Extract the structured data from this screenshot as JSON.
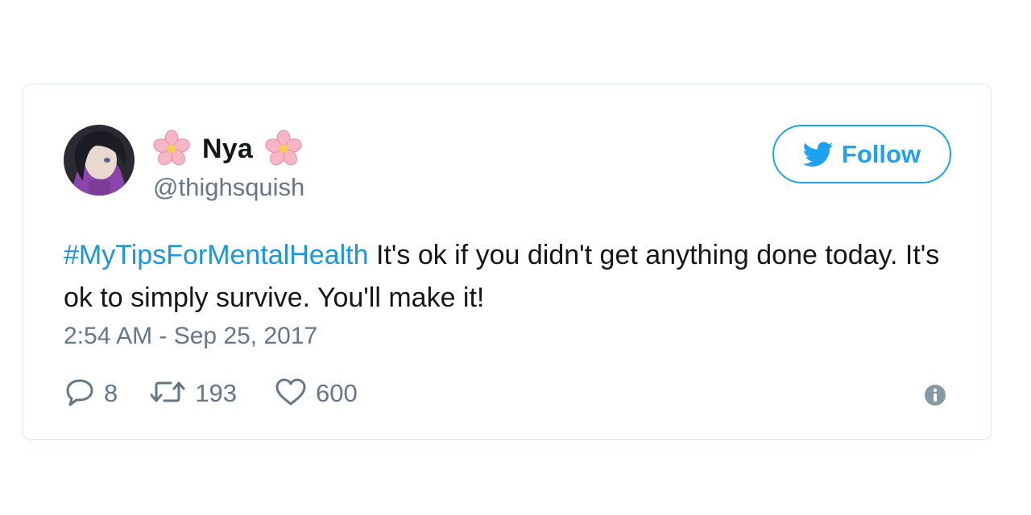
{
  "colors": {
    "accent": "#1da1f2",
    "hashtag": "#1b95e0",
    "text": "#14171a",
    "muted": "#657786",
    "border": "#e1e8ed"
  },
  "user": {
    "display_name": "Nya",
    "handle": "@thighsquish",
    "decoration_icon": "cherry-blossom-icon"
  },
  "follow_button": {
    "label": "Follow",
    "icon": "twitter-bird-icon"
  },
  "tweet": {
    "hashtag": "#MyTipsForMentalHealth",
    "text": " It's ok if you didn't get anything done today. It's ok to simply survive. You'll make it!",
    "timestamp": "2:54 AM - Sep 25, 2017"
  },
  "actions": {
    "reply": {
      "icon": "reply-icon",
      "count": "8"
    },
    "retweet": {
      "icon": "retweet-icon",
      "count": "193"
    },
    "like": {
      "icon": "heart-icon",
      "count": "600"
    },
    "info": {
      "icon": "info-icon"
    }
  }
}
